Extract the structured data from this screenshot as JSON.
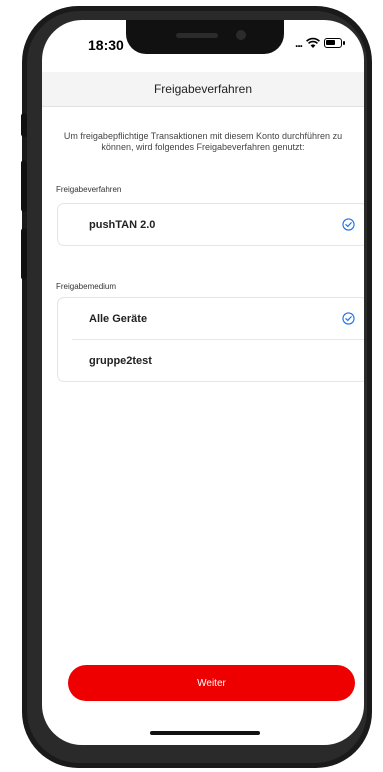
{
  "status_bar": {
    "time": "18:30",
    "signal_dots": "...",
    "icons": [
      "wifi-icon",
      "battery-icon"
    ]
  },
  "header": {
    "title": "Freigabeverfahren"
  },
  "intro_text": "Um freigabepflichtige Transaktionen mit diesem Konto durchführen zu können, wird folgendes Freigabeverfahren genutzt:",
  "sections": {
    "method": {
      "label": "Freigabeverfahren",
      "items": [
        {
          "label": "pushTAN 2.0",
          "selected": true
        }
      ]
    },
    "medium": {
      "label": "Freigabemedium",
      "items": [
        {
          "label": "Alle Geräte",
          "selected": true
        },
        {
          "label": "gruppe2test",
          "selected": false
        }
      ]
    }
  },
  "primary_button": {
    "label": "Weiter"
  },
  "colors": {
    "accent": "#ee0000",
    "check": "#1a73e8",
    "header_bg": "#f4f4f4"
  }
}
